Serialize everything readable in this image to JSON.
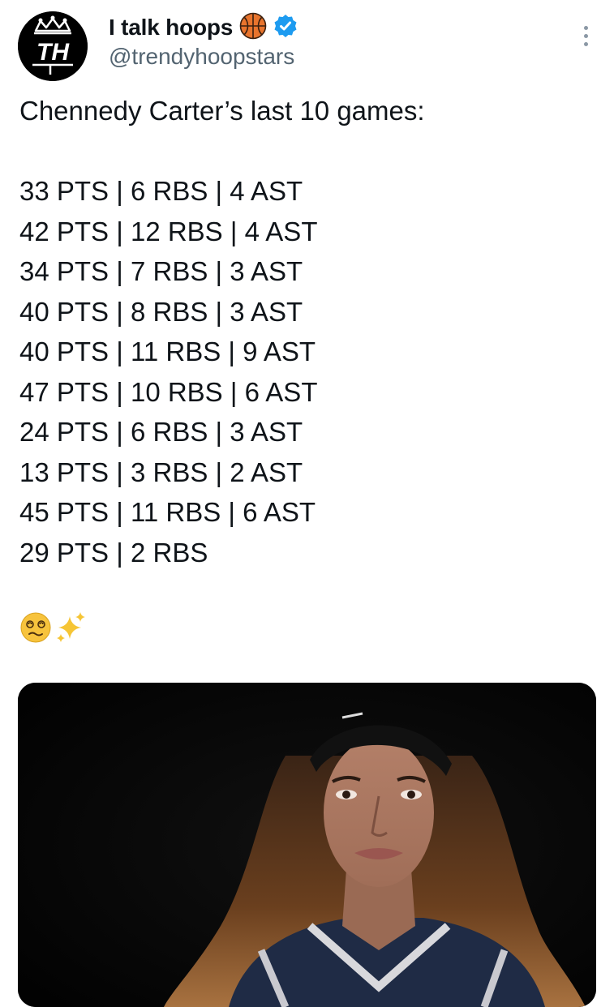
{
  "header": {
    "display_name": "I talk hoops",
    "handle": "@trendyhoopstars",
    "avatar_initials": "TH",
    "verified": true,
    "name_emoji": "basketball-icon",
    "menu_icon": "more-dots-icon"
  },
  "tweet": {
    "intro": "Chennedy Carter’s last 10 games:",
    "stat_lines": [
      "33 PTS | 6 RBS | 4 AST",
      "42 PTS | 12 RBS | 4 AST",
      "34 PTS | 7 RBS | 3 AST",
      "40 PTS | 8 RBS | 3 AST",
      "40 PTS | 11 RBS | 9 AST",
      "47 PTS | 10 RBS | 6 AST",
      "24 PTS | 6 RBS | 3 AST",
      "13 PTS | 3 RBS | 2 AST",
      "45 PTS | 11 RBS | 6 AST",
      "29 PTS | 2 RBS"
    ],
    "emojis": [
      "dizzy-face-icon",
      "sparkles-icon"
    ]
  },
  "media": {
    "type": "photo",
    "icon": "player-photo"
  },
  "colors": {
    "text": "#0f1419",
    "secondary": "#536471",
    "verified": "#1d9bf0",
    "media_bg": "#050505"
  }
}
